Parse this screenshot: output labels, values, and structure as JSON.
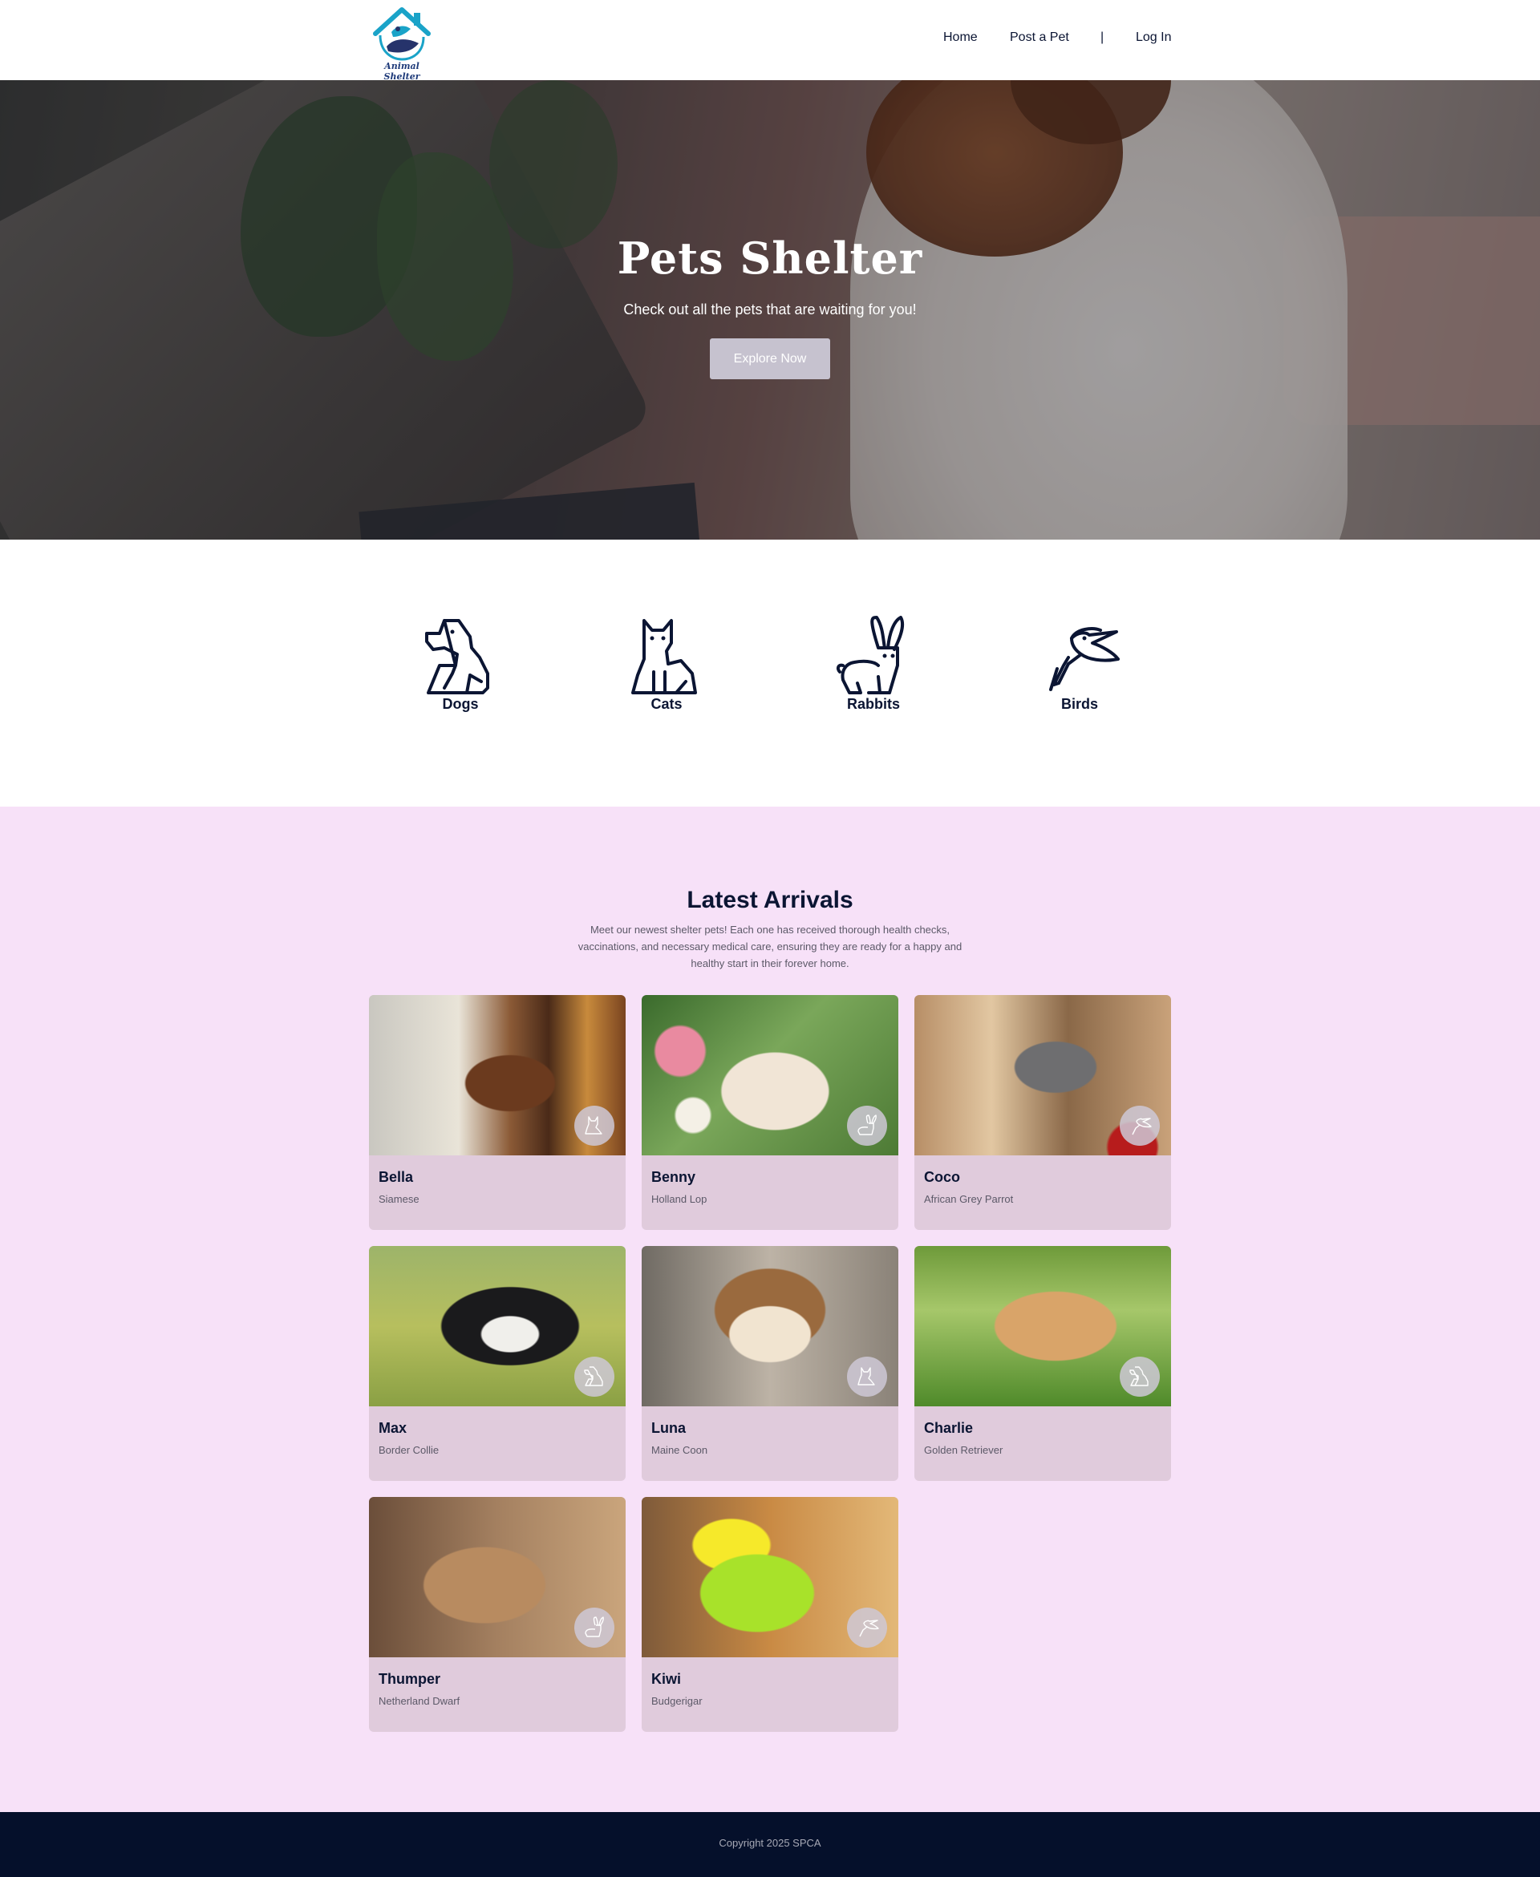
{
  "header": {
    "logo_text": "Animal Shelter",
    "nav": {
      "home": "Home",
      "post_a_pet": "Post a Pet",
      "separator": "|",
      "log_in": "Log In"
    }
  },
  "hero": {
    "title": "Pets Shelter",
    "subtitle": "Check out all the pets that are waiting for you!",
    "button_label": "Explore Now"
  },
  "categories": [
    {
      "label": "Dogs",
      "icon": "dog-icon"
    },
    {
      "label": "Cats",
      "icon": "cat-icon"
    },
    {
      "label": "Rabbits",
      "icon": "rabbit-icon"
    },
    {
      "label": "Birds",
      "icon": "bird-icon"
    }
  ],
  "arrivals": {
    "title": "Latest Arrivals",
    "description": "Meet our newest shelter pets! Each one has received thorough health checks, vaccinations, and necessary medical care, ensuring they are ready for a happy and healthy start in their forever home.",
    "pets": [
      {
        "name": "Bella",
        "breed": "Siamese",
        "type_icon": "cat-icon"
      },
      {
        "name": "Benny",
        "breed": "Holland Lop",
        "type_icon": "rabbit-icon"
      },
      {
        "name": "Coco",
        "breed": "African Grey Parrot",
        "type_icon": "bird-icon"
      },
      {
        "name": "Max",
        "breed": "Border Collie",
        "type_icon": "dog-icon"
      },
      {
        "name": "Luna",
        "breed": "Maine Coon",
        "type_icon": "cat-icon"
      },
      {
        "name": "Charlie",
        "breed": "Golden Retriever",
        "type_icon": "dog-icon"
      },
      {
        "name": "Thumper",
        "breed": "Netherland Dwarf",
        "type_icon": "rabbit-icon"
      },
      {
        "name": "Kiwi",
        "breed": "Budgerigar",
        "type_icon": "bird-icon"
      }
    ]
  },
  "footer": {
    "copyright": "Copyright 2025 SPCA"
  },
  "colors": {
    "navy": "#0b1533",
    "arrivals_background": "#f7e1f8",
    "card_background": "#e0cbdc",
    "footer_background": "#05102b",
    "hero_button": "#c6c2cf",
    "logo_teal": "#1aa3c8"
  }
}
